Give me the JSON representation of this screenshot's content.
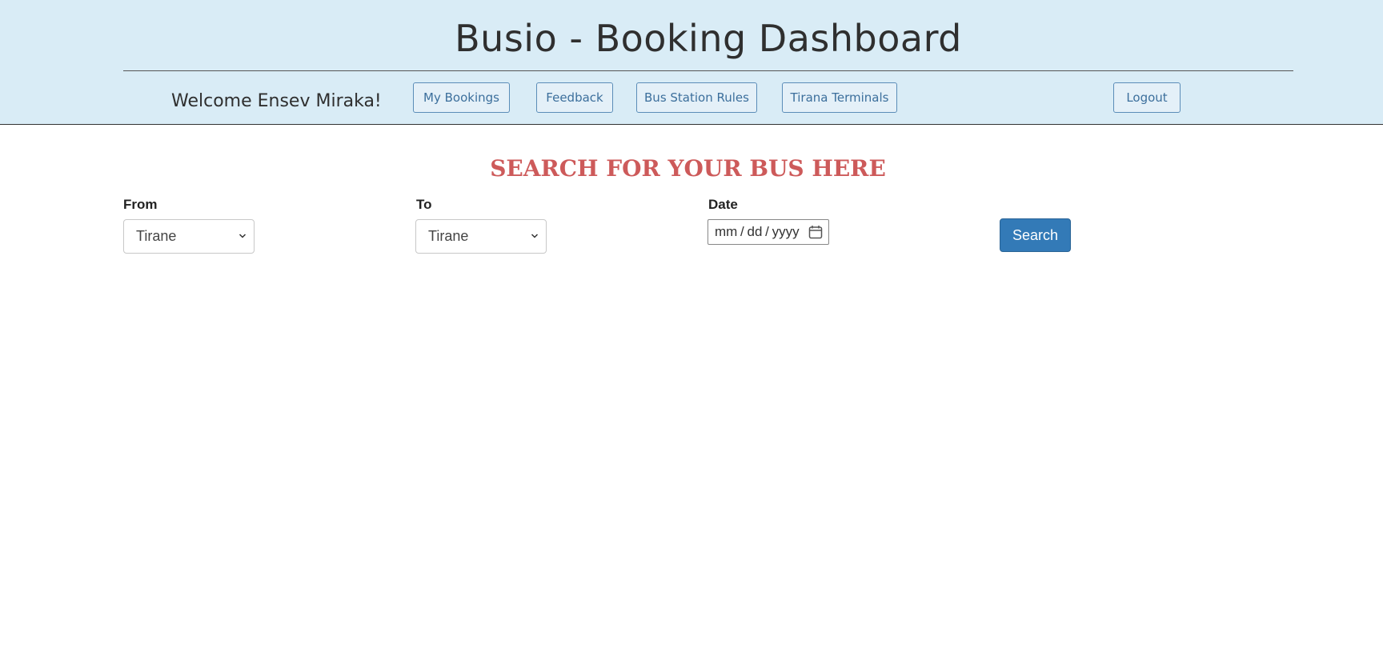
{
  "header": {
    "title": "Busio - Booking Dashboard",
    "welcome": "Welcome Ensev Miraka!",
    "nav": {
      "my_bookings": "My Bookings",
      "feedback": "Feedback",
      "bus_station_rules": "Bus Station Rules",
      "tirana_terminals": "Tirana Terminals",
      "logout": "Logout"
    }
  },
  "search": {
    "heading": "SEARCH FOR YOUR BUS HERE",
    "from_label": "From",
    "from_value": "Tirane",
    "to_label": "To",
    "to_value": "Tirane",
    "date_label": "Date",
    "date_placeholder": "mm / dd / yyyy",
    "button": "Search"
  },
  "colors": {
    "header_bg": "#d9ecf6",
    "heading": "#cd5a5a",
    "primary_button": "#337ab7",
    "nav_text": "#3c6f9c"
  },
  "icons": {
    "date": "calendar-icon",
    "select": "chevron-down-icon"
  }
}
